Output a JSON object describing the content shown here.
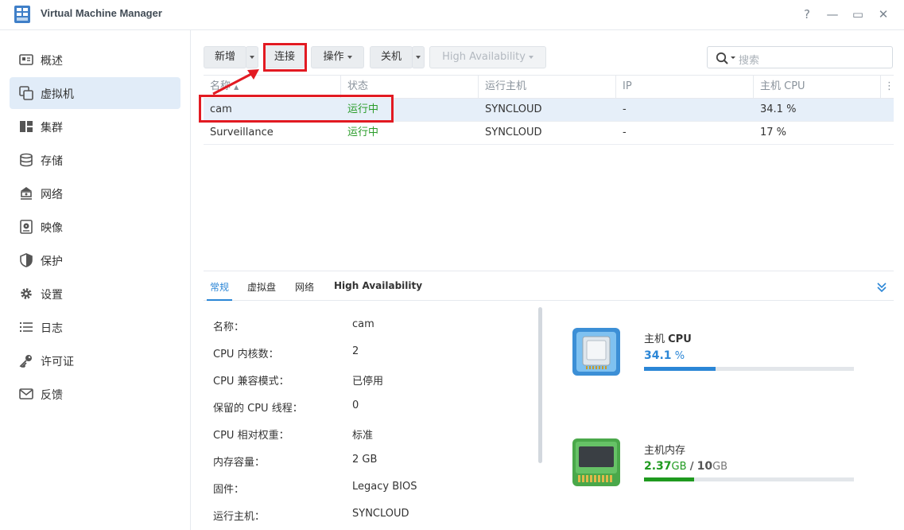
{
  "window": {
    "title": "Virtual Machine Manager",
    "help": "?",
    "minimize": "—",
    "maximize": "▭",
    "close": "✕"
  },
  "sidebar": {
    "items": [
      {
        "label": "概述",
        "icon": "overview-icon"
      },
      {
        "label": "虚拟机",
        "icon": "virtual-machine-icon",
        "active": true
      },
      {
        "label": "集群",
        "icon": "cluster-icon"
      },
      {
        "label": "存储",
        "icon": "storage-icon"
      },
      {
        "label": "网络",
        "icon": "network-icon"
      },
      {
        "label": "映像",
        "icon": "image-icon"
      },
      {
        "label": "保护",
        "icon": "shield-icon"
      },
      {
        "label": "设置",
        "icon": "gear-icon"
      },
      {
        "label": "日志",
        "icon": "log-icon"
      },
      {
        "label": "许可证",
        "icon": "key-icon"
      },
      {
        "label": "反馈",
        "icon": "mail-icon"
      }
    ]
  },
  "toolbar": {
    "create": "新增",
    "connect": "连接",
    "action": "操作",
    "shutdown": "关机",
    "high_availability": "High Availability",
    "search_placeholder": "搜索"
  },
  "table": {
    "columns": [
      "名称",
      "状态",
      "运行主机",
      "IP",
      "主机 CPU"
    ],
    "rows": [
      {
        "name": "cam",
        "status": "运行中",
        "host": "SYNCLOUD",
        "ip": "-",
        "cpu": "34.1 %"
      },
      {
        "name": "Surveillance",
        "status": "运行中",
        "host": "SYNCLOUD",
        "ip": "-",
        "cpu": "17 %"
      }
    ]
  },
  "detail": {
    "tabs": [
      "常规",
      "虚拟盘",
      "网络",
      "High Availability"
    ],
    "properties": [
      {
        "label": "名称：",
        "value": "cam"
      },
      {
        "label": "CPU 内核数：",
        "value": "2"
      },
      {
        "label": "CPU 兼容模式：",
        "value": "已停用"
      },
      {
        "label": "保留的 CPU 线程：",
        "value": "0"
      },
      {
        "label": "CPU 相对权重：",
        "value": "标准"
      },
      {
        "label": "内存容量：",
        "value": "2 GB"
      },
      {
        "label": "固件：",
        "value": "Legacy BIOS"
      },
      {
        "label": "运行主机：",
        "value": "SYNCLOUD"
      }
    ],
    "cpu": {
      "title_prefix": "主机 ",
      "title_bold": "CPU",
      "value": "34.1",
      "unit": "%",
      "percent": 34.1
    },
    "memory": {
      "title": "主机内存",
      "used": "2.37",
      "used_unit": "GB",
      "separator": "/",
      "total": "10",
      "total_unit": "GB",
      "percent": 23.7
    }
  },
  "colors": {
    "accent": "#2b86d6",
    "running": "#2a9c2a",
    "cpu_bar": "#2b86d6",
    "memory_bar": "#1f9a1f",
    "annotation": "#e21a22"
  }
}
